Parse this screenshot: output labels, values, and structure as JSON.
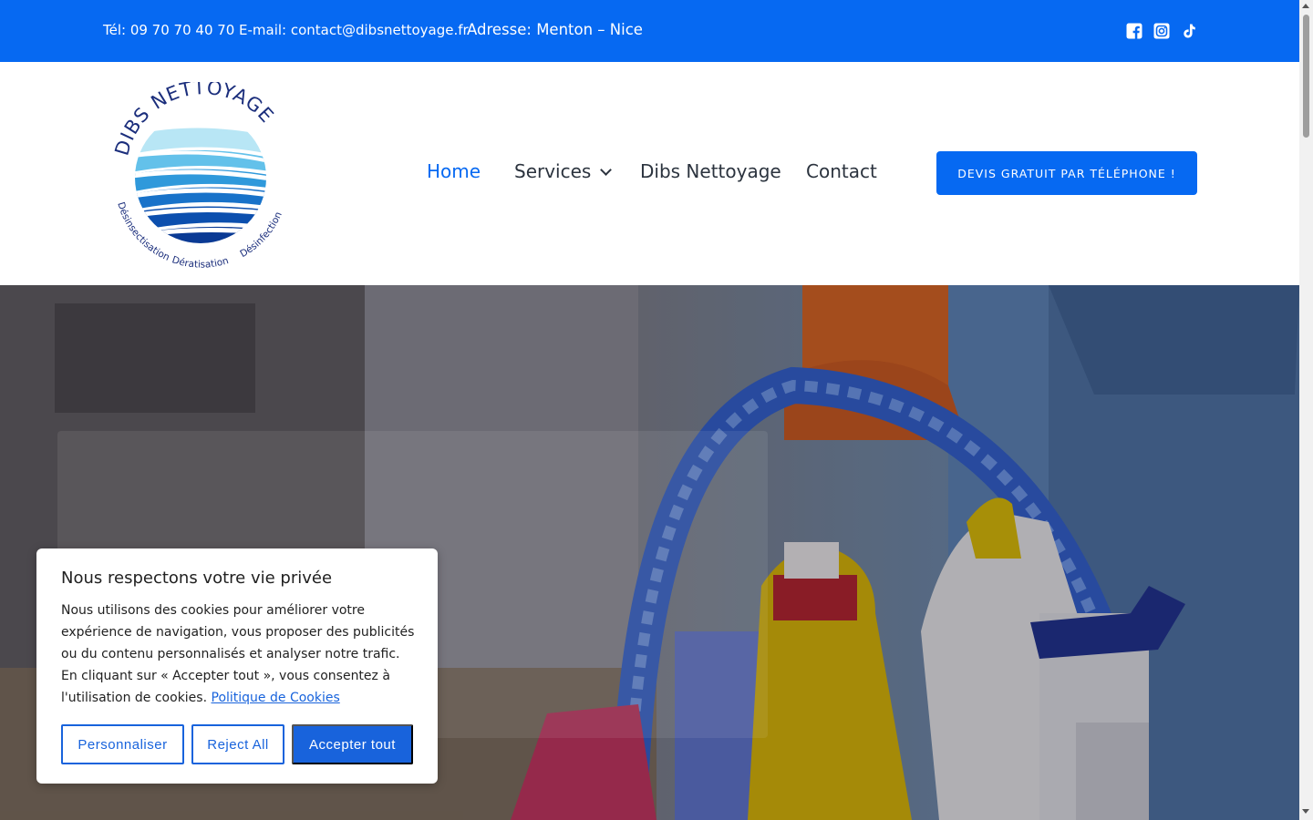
{
  "topbar": {
    "phone": "Tél: 09 70 70 40 70",
    "email": "E-mail: contact@dibsnettoyage.fr",
    "address": "Adresse: Menton – Nice",
    "social_icons": [
      "facebook-icon",
      "instagram-icon",
      "tiktok-icon"
    ],
    "background": "#0669f2"
  },
  "logo": {
    "brand": "DIBS NETTOYAGE",
    "services_left": "Désinsectisation",
    "services_bottom": "Dératisation",
    "services_right": "Désinfection"
  },
  "nav": {
    "items": [
      {
        "label": "Home",
        "active": true
      },
      {
        "label": "Services",
        "has_dropdown": true
      },
      {
        "label": "Dibs Nettoyage"
      },
      {
        "label": "Contact"
      }
    ],
    "cta": "DEVIS GRATUIT PAR TÉLÉPHONE !"
  },
  "cookie": {
    "title": "Nous respectons votre vie privée",
    "text": "Nous utilisons des cookies pour améliorer votre expérience de navigation, vous proposer des publicités ou du contenu personnalisés et analyser notre trafic. En cliquant sur « Accepter tout », vous consentez à l'utilisation de cookies.",
    "policy_link": "Politique de Cookies",
    "buttons": {
      "customize": "Personnaliser",
      "reject": "Reject All",
      "accept": "Accepter tout"
    },
    "accent": "#1863dc"
  }
}
